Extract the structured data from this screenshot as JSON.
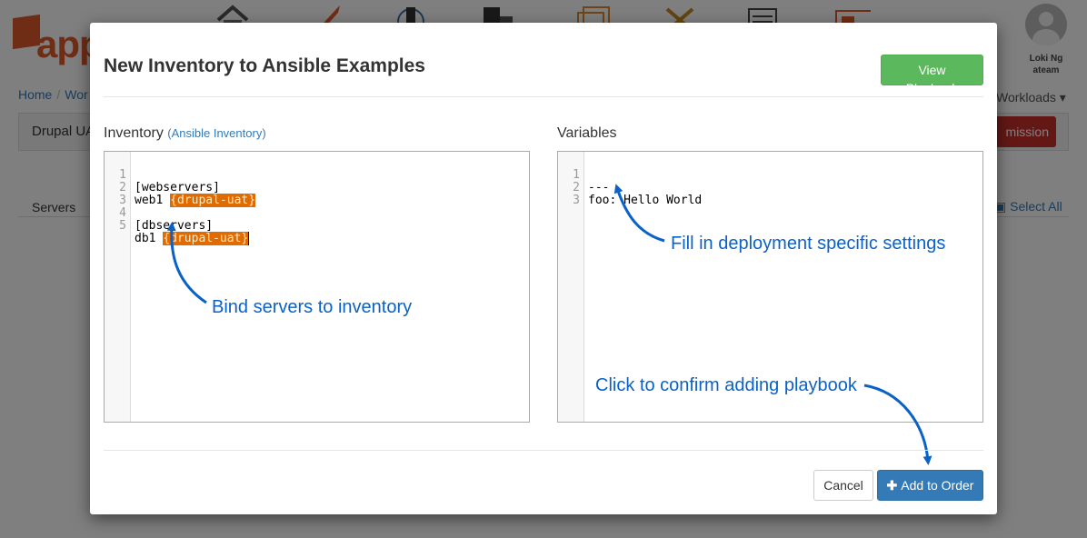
{
  "background": {
    "logo_text": "app",
    "user": {
      "name": "Loki Ng",
      "team": "ateam"
    },
    "breadcrumb": {
      "home": "Home",
      "second": "Wor"
    },
    "panel_title": "Drupal UA",
    "decommission_label": "mission",
    "workloads_label": "Workloads ▾",
    "servers_label": "Servers",
    "select_all_label": "Select All"
  },
  "modal": {
    "title": "New Inventory to Ansible Examples",
    "view_playbook_label": "View Playbook",
    "inventory": {
      "label": "Inventory",
      "link": "(Ansible Inventory)",
      "lines": [
        {
          "num": "1",
          "text": "[webservers]",
          "tag": ""
        },
        {
          "num": "2",
          "text": "web1 ",
          "tag": "{drupal-uat}"
        },
        {
          "num": "3",
          "text": "",
          "tag": ""
        },
        {
          "num": "4",
          "text": "[dbservers]",
          "tag": ""
        },
        {
          "num": "5",
          "text": "db1 ",
          "tag": "{drupal-uat}"
        }
      ]
    },
    "variables": {
      "label": "Variables",
      "lines": [
        {
          "num": "1",
          "text": "---"
        },
        {
          "num": "2",
          "text": "foo: Hello World"
        },
        {
          "num": "3",
          "text": ""
        }
      ]
    },
    "annotations": {
      "bind": "Bind servers to inventory",
      "fill": "Fill in deployment specific settings",
      "confirm": "Click to confirm adding playbook"
    },
    "cancel_label": "Cancel",
    "add_label": "Add to Order"
  },
  "colors": {
    "primary": "#337ab7",
    "success": "#5cb85c",
    "danger": "#c9302c",
    "annotation": "#0a62c8",
    "highlight": "#e06b00"
  }
}
